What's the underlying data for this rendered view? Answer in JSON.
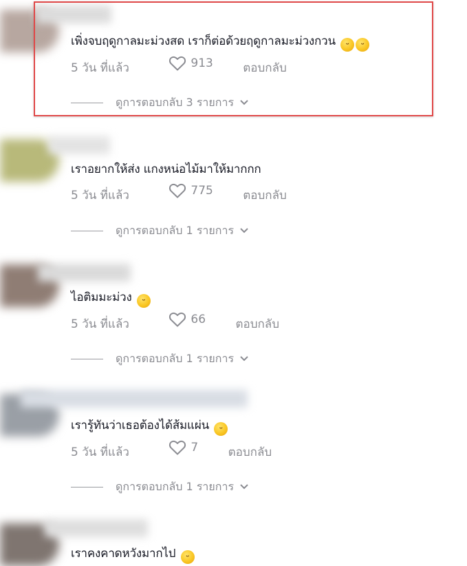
{
  "comments": [
    {
      "text": "เพิ่งจบฤดูกาลมะม่วงสด เราก็ต่อด้วยฤดูกาลมะม่วงกวน",
      "age": "5 วัน ที่แล้ว",
      "likes": "913",
      "reply_label": "ตอบกลับ",
      "view_replies": "ดูการตอบกลับ 3 รายการ",
      "emoji": [
        "face-with-tears-of-joy",
        "face-with-tears-of-joy"
      ],
      "avatar_color": "#b7a7a0"
    },
    {
      "text": "เราอยากให้ส่ง แกงหน่อไม้มาให้มากกก",
      "age": "5 วัน ที่แล้ว",
      "likes": "775",
      "reply_label": "ตอบกลับ",
      "view_replies": "ดูการตอบกลับ 1 รายการ",
      "emoji": [],
      "avatar_color": "#b8b97a"
    },
    {
      "text": "ไอติมมะม่วง",
      "age": "5 วัน ที่แล้ว",
      "likes": "66",
      "reply_label": "ตอบกลับ",
      "view_replies": "ดูการตอบกลับ 1 รายการ",
      "emoji": [
        "rolling-on-the-floor-laughing"
      ],
      "avatar_color": "#8f7d74"
    },
    {
      "text": "เรารู้ทันว่าเธอต้องได้ส้มแผ่น",
      "age": "5 วัน ที่แล้ว",
      "likes": "7",
      "reply_label": "ตอบกลับ",
      "view_replies": "ดูการตอบกลับ 1 รายการ",
      "emoji": [
        "grinning-face-with-sweat"
      ],
      "avatar_color": "#9a9fa6"
    },
    {
      "text": "เราคงคาดหวังมากไป",
      "emoji": [
        "rolling-on-the-floor-laughing"
      ],
      "avatar_color": "#7f7570"
    }
  ],
  "colors": {
    "highlight_border": "#e04848",
    "meta_text": "#8a8b91",
    "main_text": "#161823"
  }
}
